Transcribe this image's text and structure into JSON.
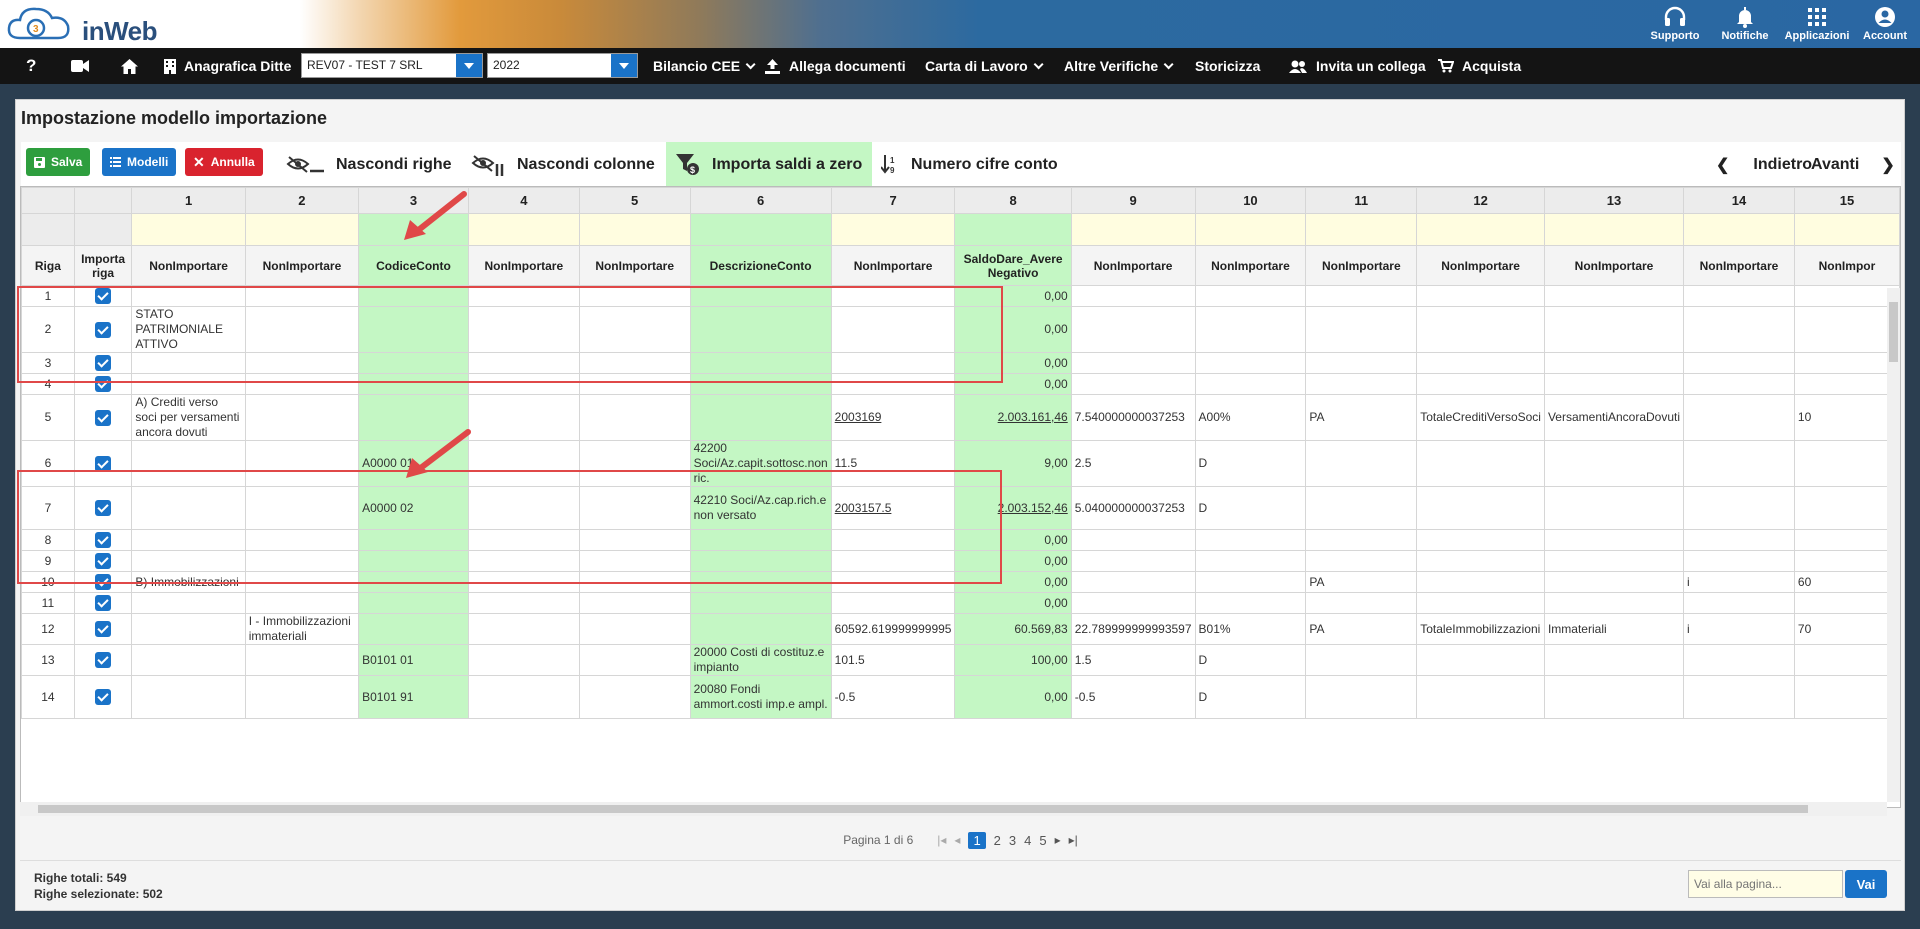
{
  "topbar": {
    "brand": "inWeb",
    "icons": [
      {
        "name": "support",
        "icon": "headset-icon",
        "label": "Supporto"
      },
      {
        "name": "notifications",
        "icon": "bell-icon",
        "label": "Notifiche"
      },
      {
        "name": "apps",
        "icon": "grid-icon",
        "label": "Applicazioni"
      },
      {
        "name": "account",
        "icon": "user-icon",
        "label": "Account"
      }
    ]
  },
  "navbar": {
    "help": "?",
    "anagrafica_label": "Anagrafica Ditte",
    "company_select": "REV07 - TEST 7 SRL",
    "year_select": "2022",
    "bilancio": "Bilancio CEE",
    "allega": "Allega documenti",
    "carta": "Carta di Lavoro",
    "altre": "Altre Verifiche",
    "storicizza": "Storicizza",
    "invita": "Invita un collega",
    "acquista": "Acquista"
  },
  "panel": {
    "title": "Impostazione modello importazione"
  },
  "toolbar": {
    "save": "Salva",
    "models": "Modelli",
    "cancel": "Annulla",
    "hide_rows": "Nascondi righe",
    "hide_cols": "Nascondi colonne",
    "import_zero": "Importa saldi a zero",
    "digits": "Numero cifre conto",
    "back": "Indietro",
    "forward": "Avanti"
  },
  "grid": {
    "col_numbers": [
      "1",
      "2",
      "3",
      "4",
      "5",
      "6",
      "7",
      "8",
      "9",
      "10",
      "11",
      "12",
      "13",
      "14",
      "15"
    ],
    "riga_header": "Riga",
    "importa_header": "Importa riga",
    "col_names": [
      "NonImportare",
      "NonImportare",
      "CodiceConto",
      "NonImportare",
      "NonImportare",
      "DescrizioneConto",
      "NonImportare",
      "SaldoDare_Avere Negativo",
      "NonImportare",
      "NonImportare",
      "NonImportare",
      "NonImportare",
      "NonImportare",
      "NonImportare",
      "NonImpor"
    ],
    "rows": [
      {
        "riga": "1",
        "c": [
          "",
          "",
          "",
          "",
          "",
          "",
          "",
          "0,00",
          "",
          "",
          "",
          "",
          "",
          "",
          ""
        ]
      },
      {
        "riga": "2",
        "c": [
          "STATO PATRIMONIALE ATTIVO",
          "",
          "",
          "",
          "",
          "",
          "",
          "0,00",
          "",
          "",
          "",
          "",
          "",
          "",
          ""
        ]
      },
      {
        "riga": "3",
        "c": [
          "",
          "",
          "",
          "",
          "",
          "",
          "",
          "0,00",
          "",
          "",
          "",
          "",
          "",
          "",
          ""
        ]
      },
      {
        "riga": "4",
        "c": [
          "",
          "",
          "",
          "",
          "",
          "",
          "",
          "0,00",
          "",
          "",
          "",
          "",
          "",
          "",
          ""
        ]
      },
      {
        "riga": "5",
        "c": [
          "A) Crediti verso soci per versamenti ancora dovuti",
          "",
          "",
          "",
          "",
          "",
          "2003169",
          "2.003.161,46",
          "7.540000000037253",
          "A00%",
          "PA",
          "TotaleCreditiVersoSoci",
          "VersamentiAncoraDovuti",
          "",
          "10"
        ]
      },
      {
        "riga": "6",
        "c": [
          "",
          "",
          "A0000 01",
          "",
          "",
          "42200 Soci/Az.capit.sottosc.non ric.",
          "11.5",
          "9,00",
          "2.5",
          "D",
          "",
          "",
          "",
          "",
          ""
        ]
      },
      {
        "riga": "7",
        "c": [
          "",
          "",
          "A0000 02",
          "",
          "",
          "42210 Soci/Az.cap.rich.e non versato",
          "2003157.5",
          "2.003.152,46",
          "5.040000000037253",
          "D",
          "",
          "",
          "",
          "",
          ""
        ]
      },
      {
        "riga": "8",
        "c": [
          "",
          "",
          "",
          "",
          "",
          "",
          "",
          "0,00",
          "",
          "",
          "",
          "",
          "",
          "",
          ""
        ]
      },
      {
        "riga": "9",
        "c": [
          "",
          "",
          "",
          "",
          "",
          "",
          "",
          "0,00",
          "",
          "",
          "",
          "",
          "",
          "",
          ""
        ]
      },
      {
        "riga": "10",
        "c": [
          "B) Immobilizzazioni",
          "",
          "",
          "",
          "",
          "",
          "",
          "0,00",
          "",
          "",
          "PA",
          "",
          "",
          "i",
          "60"
        ]
      },
      {
        "riga": "11",
        "c": [
          "",
          "",
          "",
          "",
          "",
          "",
          "",
          "0,00",
          "",
          "",
          "",
          "",
          "",
          "",
          ""
        ]
      },
      {
        "riga": "12",
        "c": [
          "",
          "I - Immobilizzazioni immateriali",
          "",
          "",
          "",
          "",
          "60592.619999999995",
          "60.569,83",
          "22.789999999993597",
          "B01%",
          "PA",
          "TotaleImmobilizzazioni",
          "Immateriali",
          "i",
          "70"
        ]
      },
      {
        "riga": "13",
        "c": [
          "",
          "",
          "B0101 01",
          "",
          "",
          "20000 Costi di costituz.e impianto",
          "101.5",
          "100,00",
          "1.5",
          "D",
          "",
          "",
          "",
          "",
          ""
        ]
      },
      {
        "riga": "14",
        "c": [
          "",
          "",
          "B0101 91",
          "",
          "",
          "20080 Fondi ammort.costi imp.e ampl.",
          "-0.5",
          "0,00",
          "-0.5",
          "D",
          "",
          "",
          "",
          "",
          ""
        ]
      }
    ]
  },
  "pager": {
    "label": "Pagina 1 di 6",
    "pages": [
      "1",
      "2",
      "3",
      "4",
      "5"
    ]
  },
  "footer": {
    "total_rows": "Righe totali: 549",
    "selected_rows": "Righe selezionate: 502",
    "goto_placeholder": "Vai alla pagina...",
    "goto_button": "Vai"
  },
  "colors": {
    "accent": "#1a73c8",
    "save": "#2e9e3e",
    "cancel": "#d9232e",
    "highlight": "#c4f7c4",
    "annotation": "#e04848"
  }
}
